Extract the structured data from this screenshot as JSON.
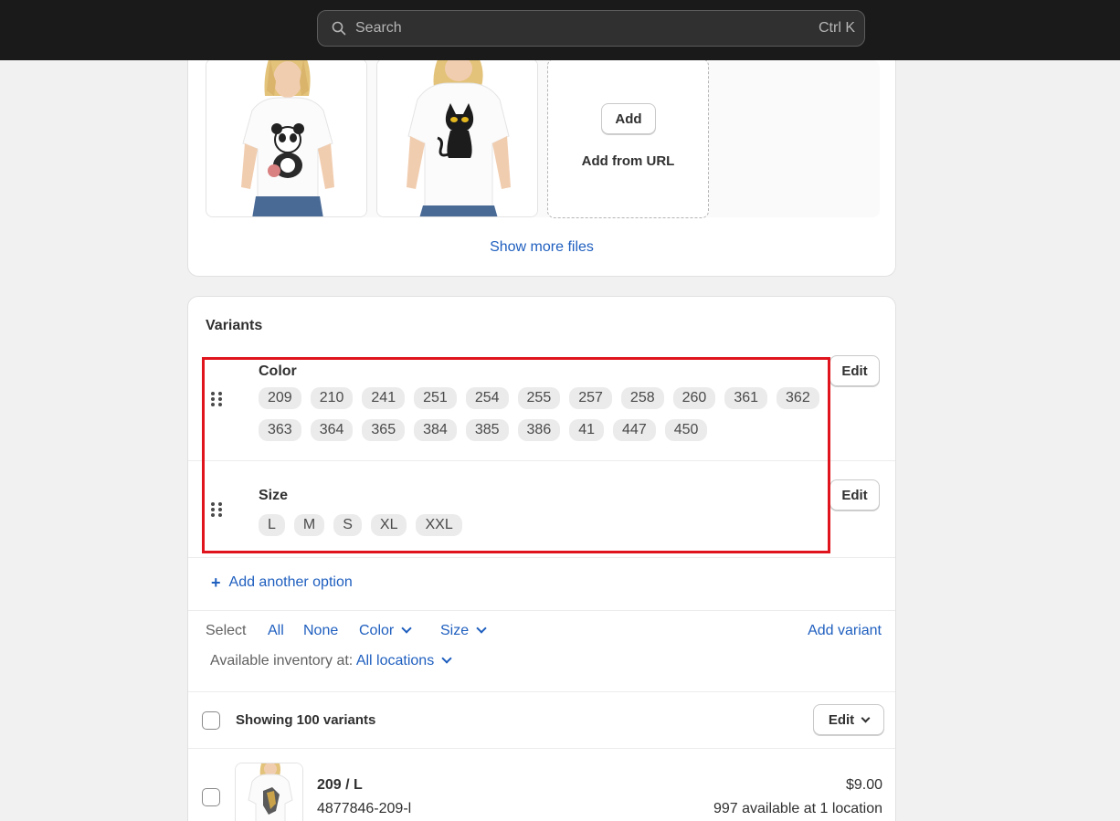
{
  "search": {
    "placeholder": "Search",
    "shortcut": "Ctrl K"
  },
  "media": {
    "add_label": "Add",
    "add_from_url_label": "Add from URL",
    "show_more_label": "Show more files"
  },
  "variants": {
    "title": "Variants",
    "options": [
      {
        "name": "Color",
        "edit_label": "Edit",
        "values": [
          "209",
          "210",
          "241",
          "251",
          "254",
          "255",
          "257",
          "258",
          "260",
          "361",
          "362",
          "363",
          "364",
          "365",
          "384",
          "385",
          "386",
          "41",
          "447",
          "450"
        ]
      },
      {
        "name": "Size",
        "edit_label": "Edit",
        "values": [
          "L",
          "M",
          "S",
          "XL",
          "XXL"
        ]
      }
    ],
    "add_option_label": "Add another option",
    "select_label": "Select",
    "filter_all": "All",
    "filter_none": "None",
    "filter_color": "Color",
    "filter_size": "Size",
    "add_variant_label": "Add variant",
    "inventory_label": "Available inventory at:",
    "inventory_value": "All locations",
    "showing_label": "Showing 100 variants",
    "bulk_edit_label": "Edit",
    "rows": [
      {
        "name": "209 / L",
        "sku": "4877846-209-l",
        "price": "$9.00",
        "availability": "997 available at 1 location"
      }
    ]
  },
  "colors": {
    "accent_link": "#1f5fbf",
    "highlight": "#e0141c",
    "topbar": "#1a1a1a"
  }
}
